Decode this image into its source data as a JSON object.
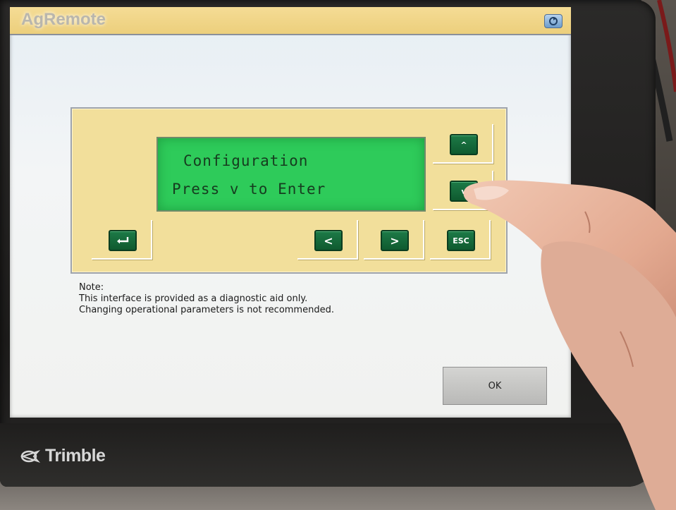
{
  "window": {
    "title": "AgRemote"
  },
  "remote": {
    "lcd_line1": "Configuration",
    "lcd_line2": "Press v to Enter",
    "keys": {
      "up": "^",
      "down": "v",
      "enter": "enter-icon",
      "left": "<",
      "right": ">",
      "esc": "ESC"
    }
  },
  "note": {
    "heading": "Note:",
    "line1": "This interface is provided as a diagnostic aid only.",
    "line2": "Changing operational parameters is not recommended."
  },
  "buttons": {
    "ok_label": "OK"
  },
  "device": {
    "brand": "Trimble"
  },
  "colors": {
    "panel": "#f2df9b",
    "lcd": "#2ecb5a",
    "key": "#1d7a47",
    "titlebar": "#eccf7c"
  }
}
